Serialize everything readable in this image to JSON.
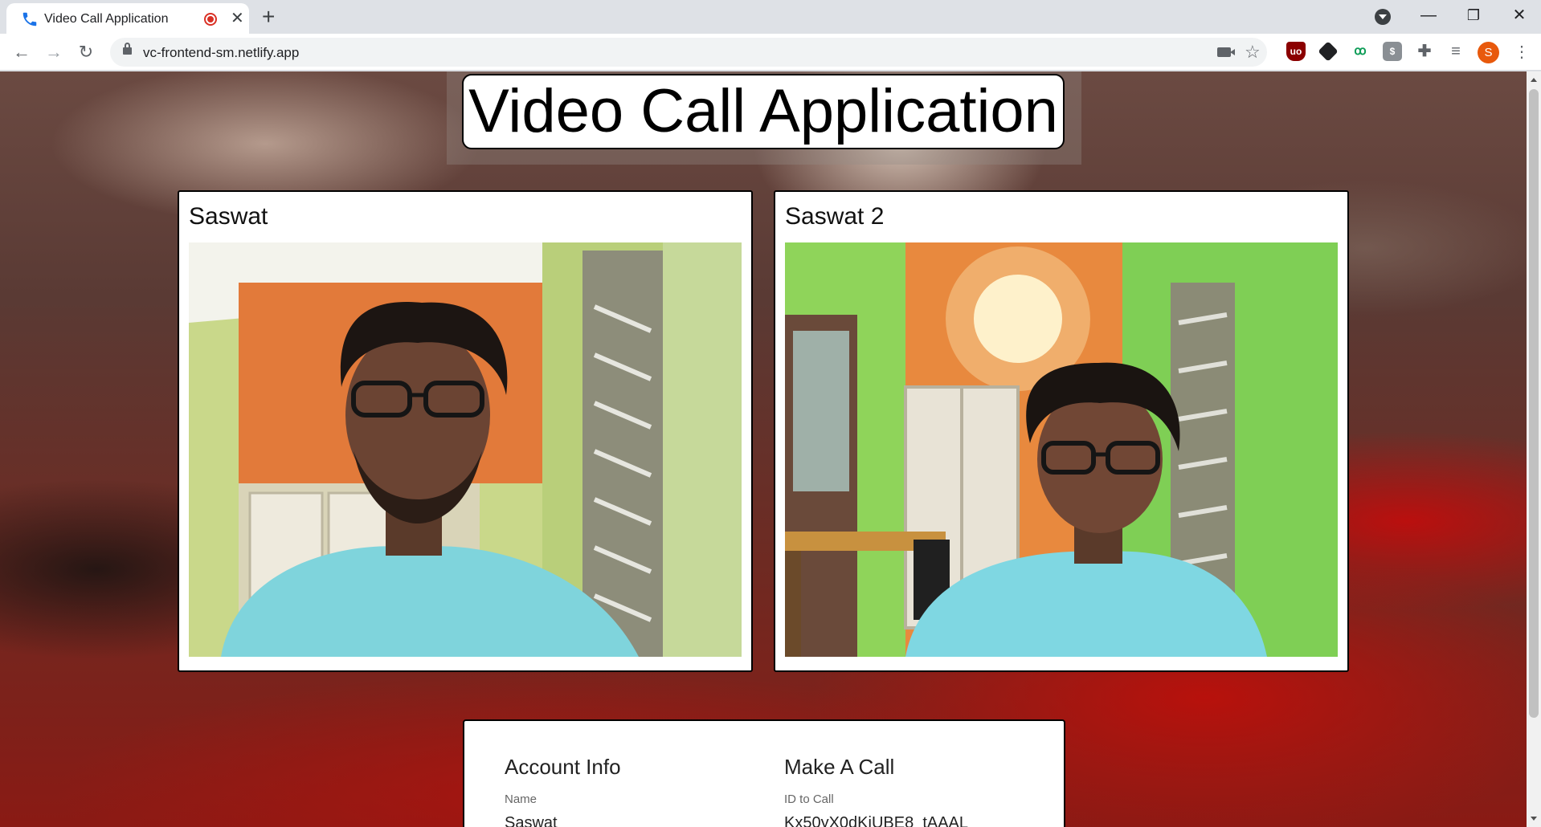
{
  "browser": {
    "tab_title": "Video Call Application",
    "url": "vc-frontend-sm.netlify.app",
    "profile_initial": "S",
    "extensions": [
      "ublock-icon",
      "cube-icon",
      "m-icon",
      "dollar-icon",
      "puzzle-icon",
      "media-icon"
    ]
  },
  "page": {
    "title": "Video Call Application",
    "videos": [
      {
        "name": "Saswat"
      },
      {
        "name": "Saswat 2"
      }
    ],
    "account": {
      "heading": "Account Info",
      "name_label": "Name",
      "name_value": "Saswat"
    },
    "call": {
      "heading": "Make A Call",
      "id_label": "ID to Call",
      "id_value": "Kx50yX0dKjUBE8_tAAAL"
    }
  },
  "colors": {
    "recording": "#d93025",
    "wall_orange": "#e27a3a",
    "wall_green": "#a8d56a",
    "shirt": "#6fd3df"
  }
}
